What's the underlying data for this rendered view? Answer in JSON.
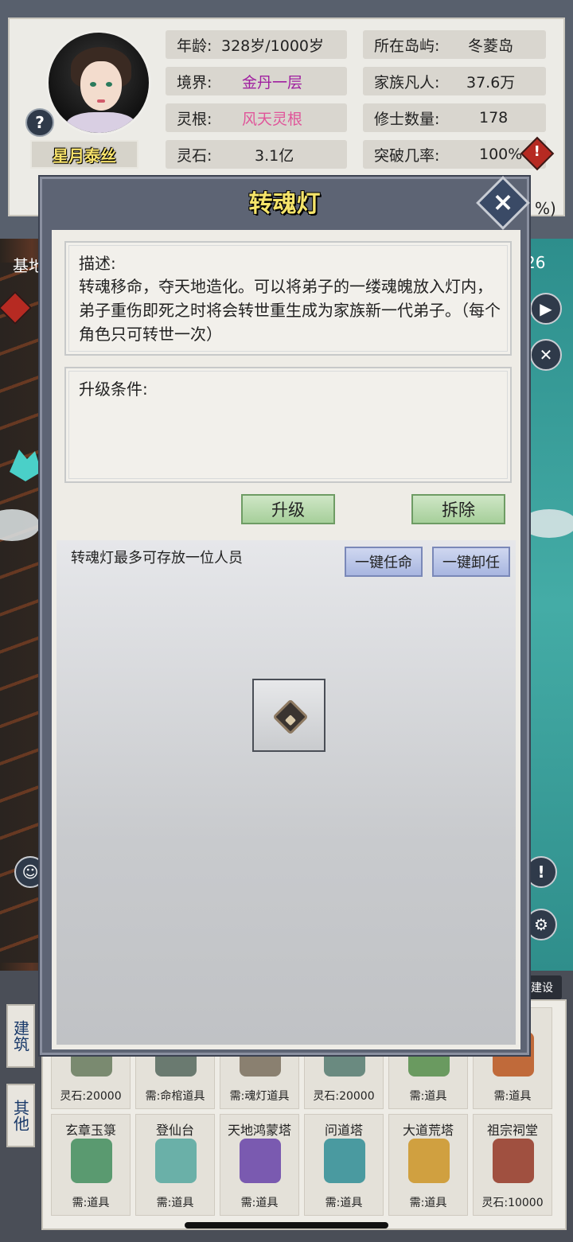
{
  "profile": {
    "name": "星月泰丝",
    "help_icon": "question-icon",
    "stats": [
      {
        "key": "年龄:",
        "value": "328岁/1000岁",
        "color": "#222222"
      },
      {
        "key": "所在岛屿:",
        "value": "冬菱岛",
        "color": "#222222"
      },
      {
        "key": "境界:",
        "value": "金丹一层",
        "color": "#a020a0"
      },
      {
        "key": "家族凡人:",
        "value": "37.6万",
        "color": "#222222"
      },
      {
        "key": "灵根:",
        "value": "风天灵根",
        "color": "#e0559a"
      },
      {
        "key": "修士数量:",
        "value": "178",
        "color": "#222222"
      },
      {
        "key": "灵石:",
        "value": "3.1亿",
        "color": "#222222"
      },
      {
        "key": "突破几率:",
        "value": "100%",
        "color": "#222222"
      }
    ],
    "partial_stat": "%)"
  },
  "background": {
    "left_label": "基地",
    "right_number": "26"
  },
  "dialog": {
    "title": "转魂灯",
    "close_icon": "close-icon",
    "description_label": "描述:",
    "description_text": "转魂移命，夺天地造化。可以将弟子的一缕魂魄放入灯内，弟子重伤即死之时将会转世重生成为家族新一代弟子。（每个角色只可转世一次）",
    "upgrade_label": "升级条件:",
    "upgrade_text": "",
    "upgrade_button": "升级",
    "demolish_button": "拆除",
    "capacity_hint": "转魂灯最多可存放一位人员",
    "assign_all_button": "一键任命",
    "dismiss_all_button": "一键卸任",
    "slot_icon": "add-slot-icon"
  },
  "bottom": {
    "tabs": [
      "建筑",
      "其他"
    ],
    "build_tag": "建设",
    "row1": [
      {
        "need": "灵石:20000",
        "color": "#7a8a70"
      },
      {
        "need": "需:命棺道具",
        "color": "#6a7a70"
      },
      {
        "need": "需:魂灯道具",
        "color": "#8a8070"
      },
      {
        "need": "灵石:20000",
        "color": "#6a8a80"
      },
      {
        "need": "需:道具",
        "color": "#6a9a60"
      },
      {
        "need": "需:道具",
        "color": "#c06a3a"
      }
    ],
    "row2": [
      {
        "name": "玄章玉箓",
        "need": "需:道具",
        "color": "#5a9a70"
      },
      {
        "name": "登仙台",
        "need": "需:道具",
        "color": "#6ab0a8"
      },
      {
        "name": "天地鸿蒙塔",
        "need": "需:道具",
        "color": "#7a5ab0"
      },
      {
        "name": "问道塔",
        "need": "需:道具",
        "color": "#4a9aa0"
      },
      {
        "name": "大道荒塔",
        "need": "需:道具",
        "color": "#d0a040"
      },
      {
        "name": "祖宗祠堂",
        "need": "灵石:10000",
        "color": "#a05040"
      }
    ]
  }
}
